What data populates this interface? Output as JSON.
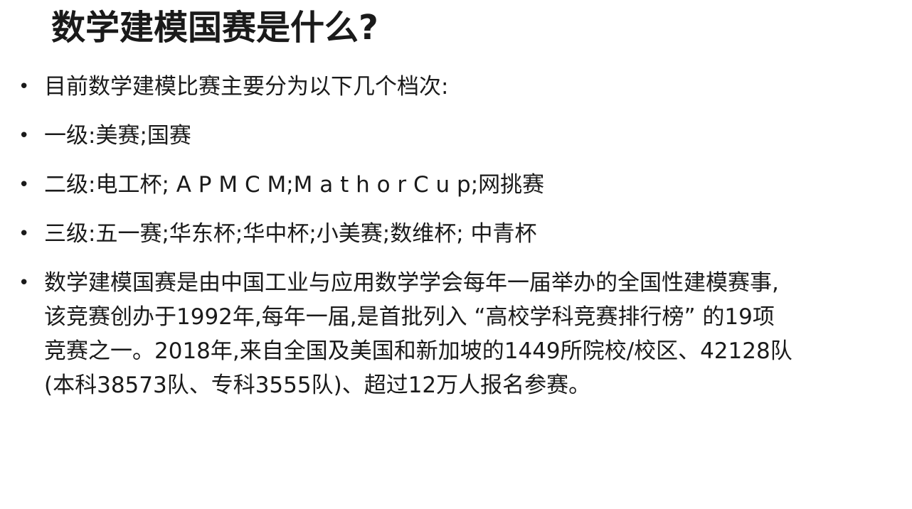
{
  "slide": {
    "title": "数学建模国赛是什么?",
    "bullets": [
      {
        "text": "目前数学建模比赛主要分为以下几个档次:"
      },
      {
        "text": "一级:美赛;国赛"
      },
      {
        "text": "二级:电工杯; A P M C M;M a t h o r C u p;网挑赛"
      },
      {
        "text": "三级:五一赛;华东杯;华中杯;小美赛;数维杯; 中青杯"
      }
    ],
    "paragraph": {
      "lines": [
        "数学建模国赛是由中国工业与应用数学学会每年一届举办的全国性建模赛事,",
        "该竞赛创办于1992年,每年一届,是首批列入 “高校学科竞赛排行榜” 的19项",
        "竞赛之一。2018年,来自全国及美国和新加坡的1449所院校/校区、42128队",
        "(本科38573队、专科3555队)、超过12万人报名参赛。"
      ]
    },
    "bullet_symbol": "•"
  }
}
